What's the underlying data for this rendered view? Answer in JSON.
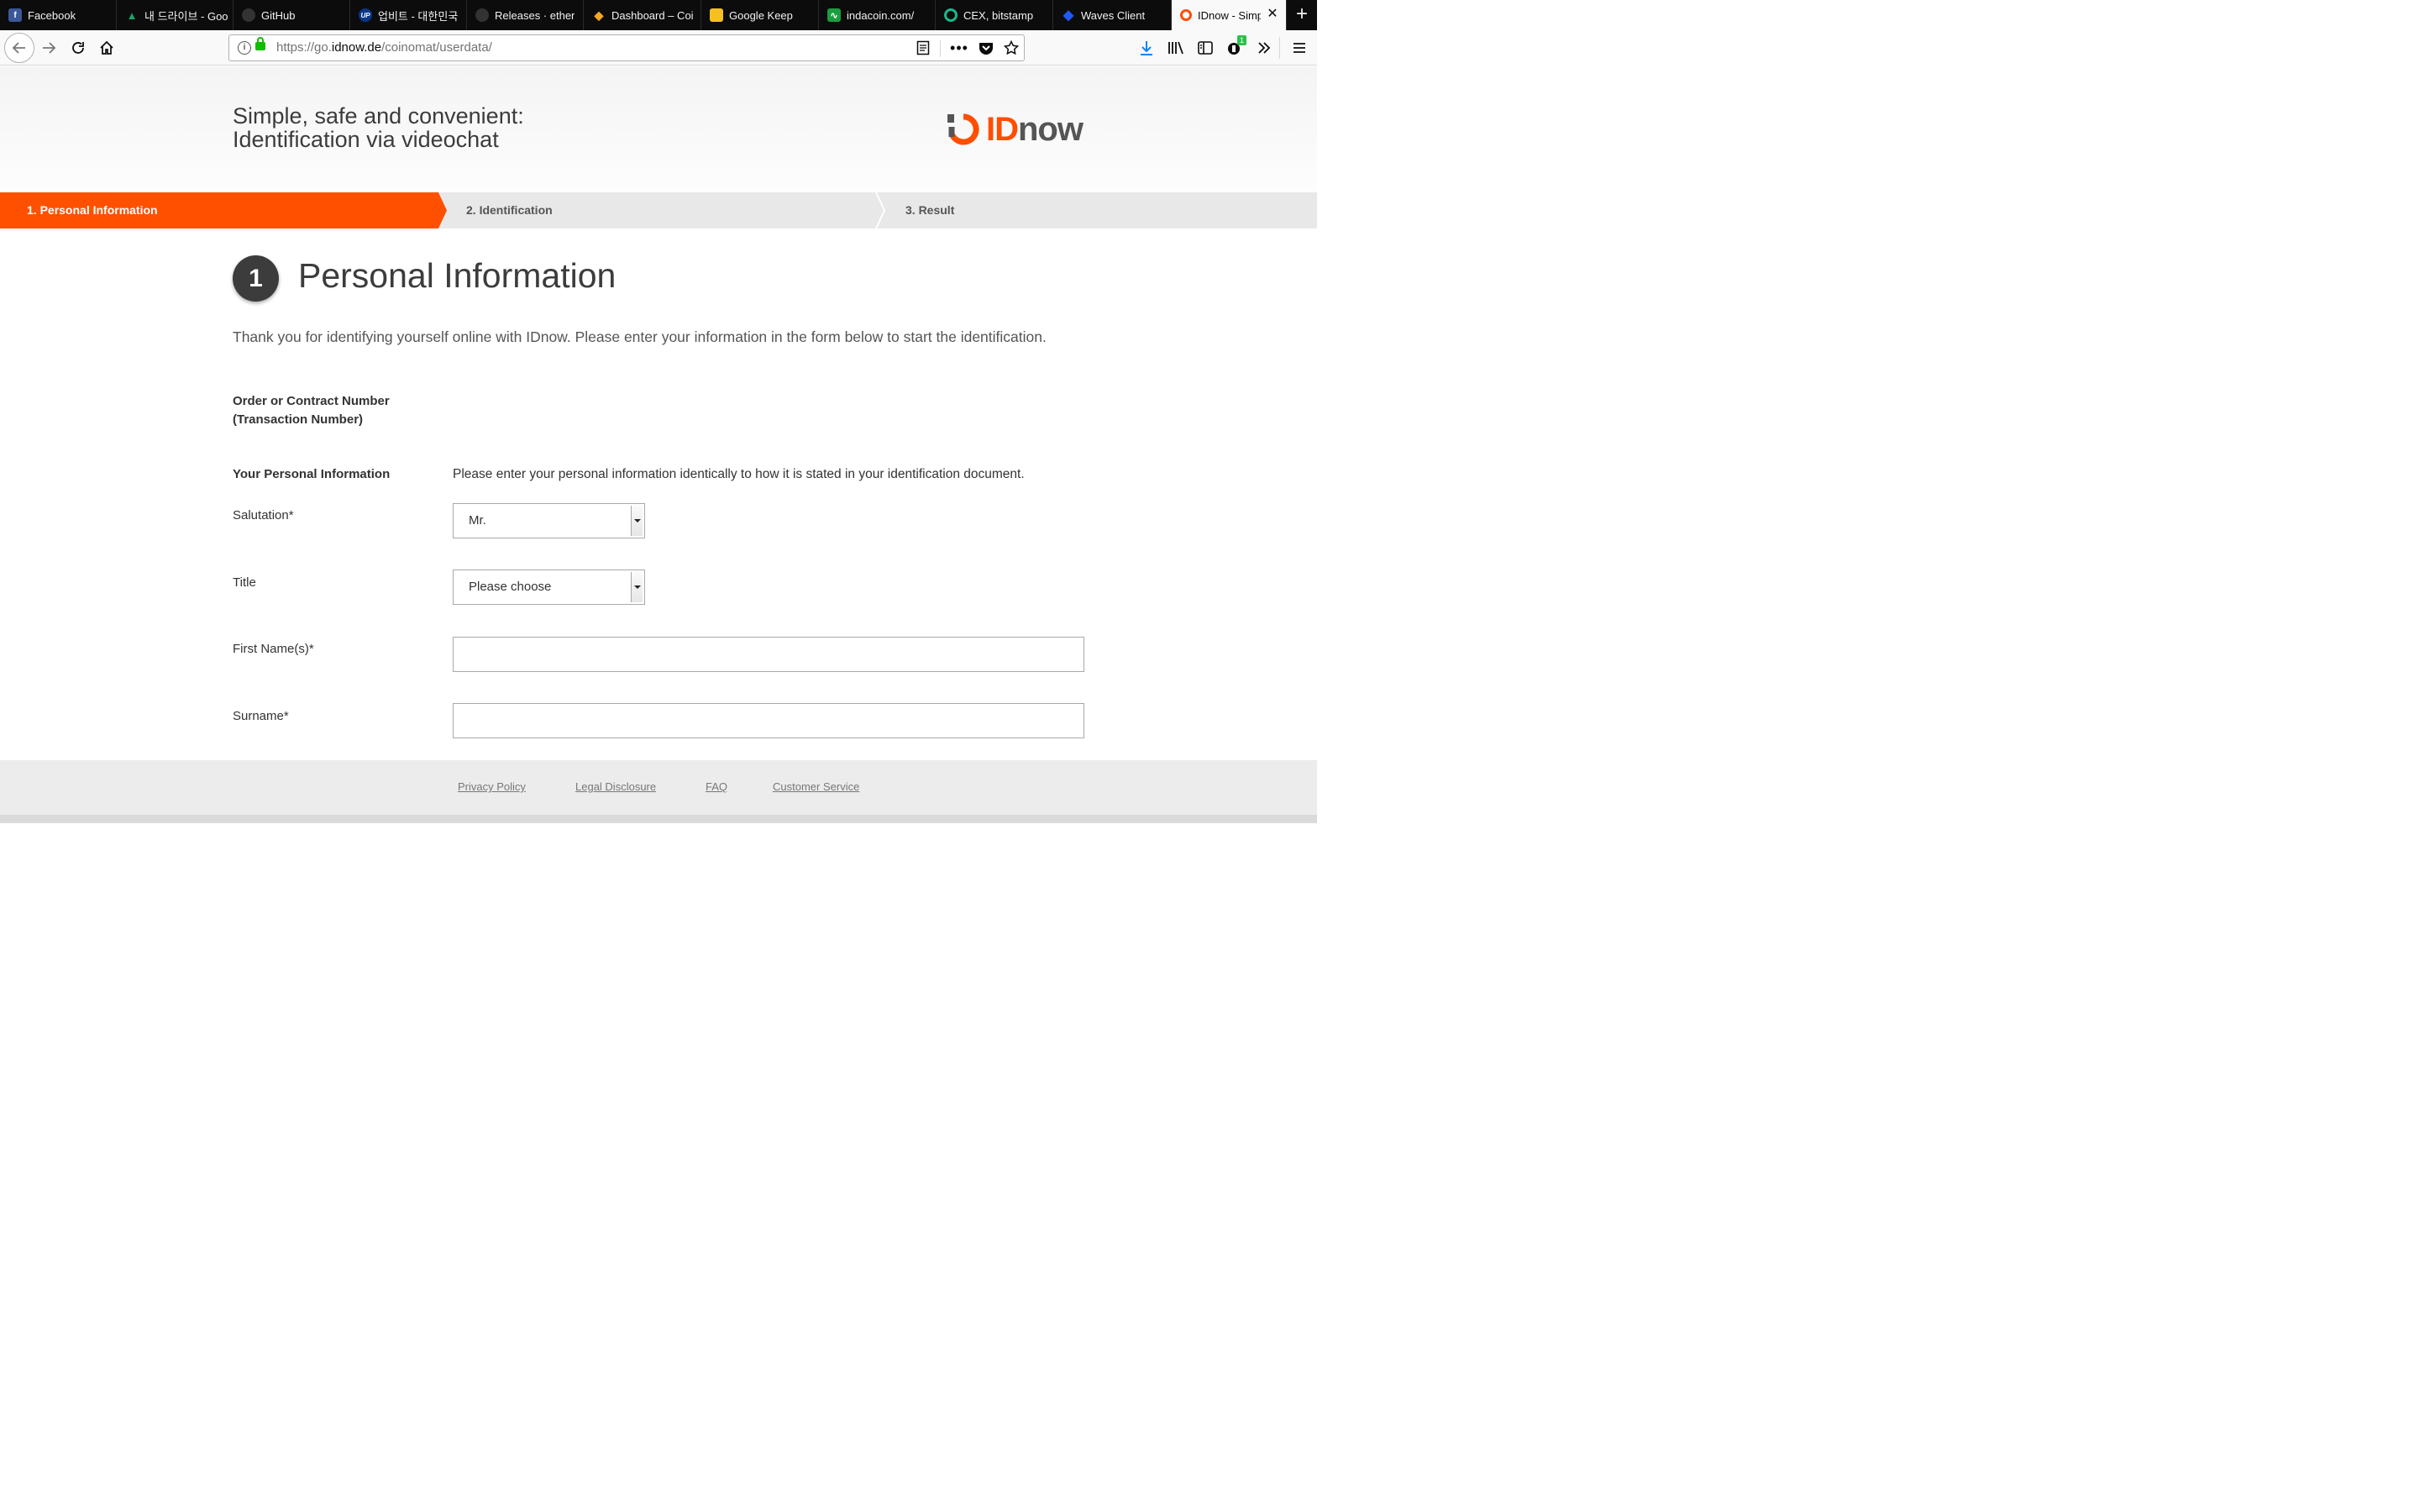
{
  "browser": {
    "tabs": [
      {
        "label": "Facebook",
        "icon": "facebook-icon",
        "color": "#3b5998",
        "glyph": "f"
      },
      {
        "label": "내 드라이브 - Goo",
        "icon": "google-drive-icon",
        "color": "#1fa463",
        "glyph": "▲"
      },
      {
        "label": "GitHub",
        "icon": "github-icon",
        "color": "#333333",
        "glyph": "●"
      },
      {
        "label": "업비트 - 대한민국 ",
        "icon": "upbit-icon",
        "color": "#093687",
        "glyph": "UP"
      },
      {
        "label": "Releases · ether",
        "icon": "github-icon",
        "color": "#333333",
        "glyph": "●"
      },
      {
        "label": "Dashboard – Coi",
        "icon": "coinbase-icon",
        "color": "#f5a623",
        "glyph": "◆"
      },
      {
        "label": "Google Keep",
        "icon": "google-keep-icon",
        "color": "#f6bf26",
        "glyph": "💡"
      },
      {
        "label": "indacoin.com/",
        "icon": "indacoin-icon",
        "color": "#1b9e3e",
        "glyph": "∿"
      },
      {
        "label": "CEX, bitstamp",
        "icon": "cex-icon",
        "color": "#1fb58a",
        "glyph": "C"
      },
      {
        "label": "Waves Client",
        "icon": "waves-icon",
        "color": "#1f5af6",
        "glyph": "◆"
      },
      {
        "label": "IDnow - Simp",
        "icon": "idnow-icon",
        "color": "#ff4e00",
        "glyph": "◔"
      }
    ],
    "url_prefix": "https://go.",
    "url_domain": "idnow.de",
    "url_path": "/coinomat/userdata/",
    "pocket_badge": "1"
  },
  "header": {
    "tagline_line1": "Simple, safe and convenient:",
    "tagline_line2": "Identification via videochat",
    "logo_id": "ID",
    "logo_now": "now"
  },
  "steps": {
    "step1": "1. Personal Information",
    "step2": "2. Identification",
    "step3": "3. Result"
  },
  "content": {
    "step_number": "1",
    "heading": "Personal Information",
    "intro": "Thank you for identifying yourself online with IDnow. Please enter your information in the form below to start the identification.",
    "order_label_1": "Order or Contract Number",
    "order_label_2": "(Transaction Number)",
    "personal_label": "Your Personal Information",
    "personal_hint": "Please enter your personal information identically to how it is stated in your identification document.",
    "salutation_label": "Salutation*",
    "salutation_value": "Mr.",
    "title_label": "Title",
    "title_value": "Please choose",
    "firstname_label": "First Name(s)*",
    "firstname_value": "",
    "surname_label": "Surname*",
    "surname_value": ""
  },
  "footer": {
    "privacy": "Privacy Policy",
    "legal": "Legal Disclosure",
    "faq": "FAQ",
    "service": "Customer Service"
  },
  "colors": {
    "accent": "#ff5000",
    "step_bg": "#e8e8e8",
    "dark": "#3c3c3c"
  }
}
